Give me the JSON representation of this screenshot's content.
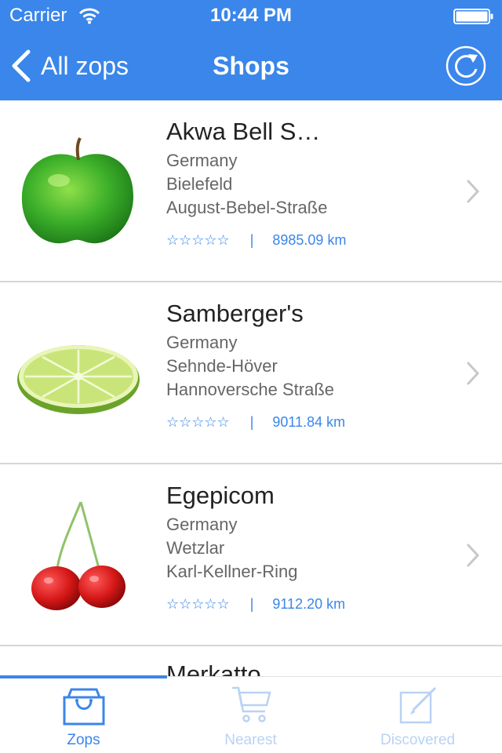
{
  "status_bar": {
    "carrier": "Carrier",
    "time": "10:44 PM"
  },
  "nav": {
    "back_label": "All zops",
    "title": "Shops"
  },
  "colors": {
    "accent": "#3a86ea",
    "inactive_tab": "#b9d2f4"
  },
  "shops": [
    {
      "name": "Akwa Bell S…",
      "country": "Germany",
      "city": "Bielefeld",
      "street": "August-Bebel-Straße",
      "stars": "☆☆☆☆☆",
      "separator": "|",
      "distance": "8985.09 km",
      "image": "green-apple-icon"
    },
    {
      "name": "Samberger's",
      "country": "Germany",
      "city": "Sehnde-Höver",
      "street": "Hannoversche Straße",
      "stars": "☆☆☆☆☆",
      "separator": "|",
      "distance": "9011.84 km",
      "image": "lime-slice-icon"
    },
    {
      "name": "Egepicom",
      "country": "Germany",
      "city": "Wetzlar",
      "street": "Karl-Kellner-Ring",
      "stars": "☆☆☆☆☆",
      "separator": "|",
      "distance": "9112.20 km",
      "image": "cherries-icon"
    },
    {
      "name": "Merkatto"
    }
  ],
  "tabs": [
    {
      "label": "Zops",
      "icon": "shopping-bag-icon",
      "active": true
    },
    {
      "label": "Nearest",
      "icon": "cart-icon",
      "active": false
    },
    {
      "label": "Discovered",
      "icon": "edit-icon",
      "active": false
    }
  ]
}
